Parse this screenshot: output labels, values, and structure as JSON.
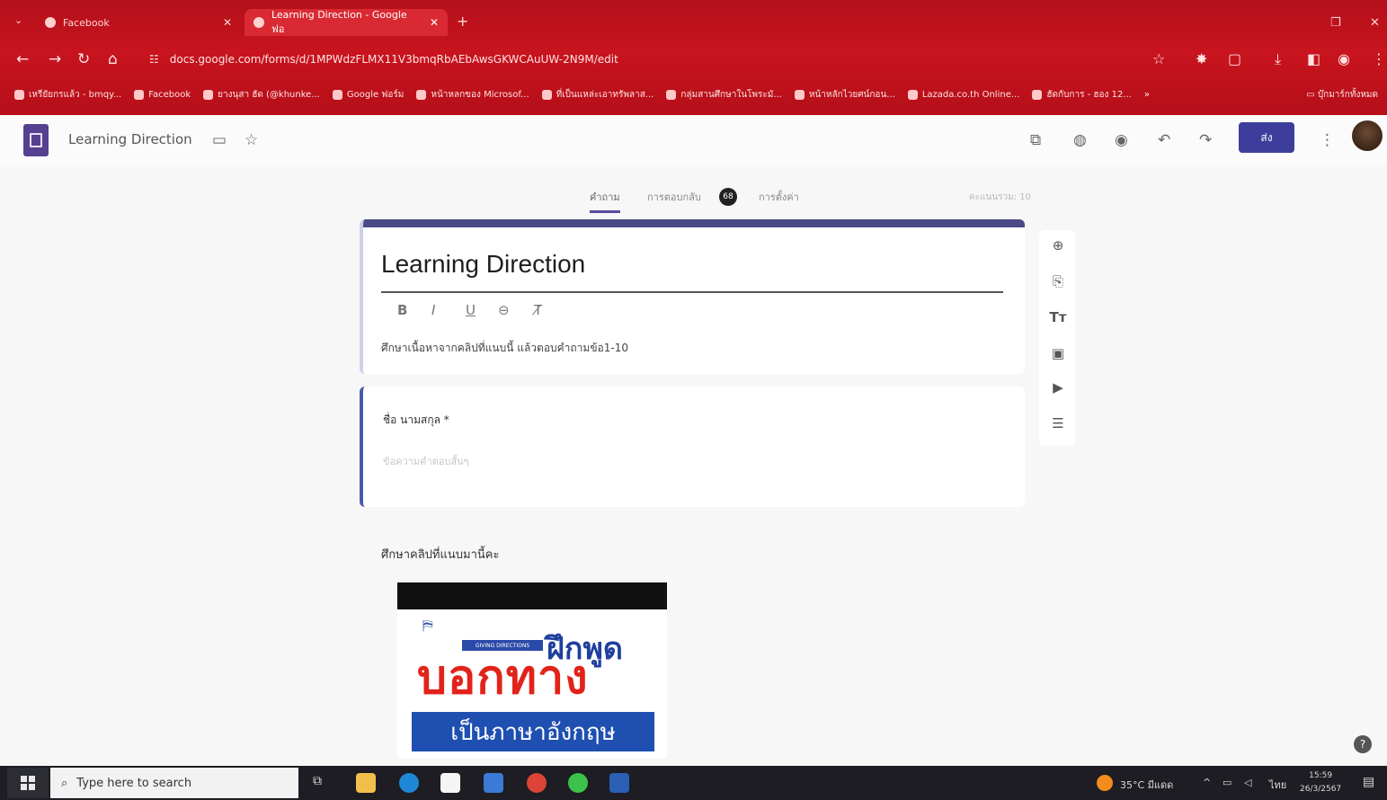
{
  "browser": {
    "tabs": [
      {
        "label": "Facebook"
      },
      {
        "label": "Learning Direction - Google ฟอ"
      }
    ],
    "new_tab": "+",
    "url": "docs.google.com/forms/d/1MPWdzFLMX11V3bmqRbAEbAwsGKWCAuUW-2N9M/edit",
    "bookmarks": [
      "เหรียัยกรแล้ว - bmqy...",
      "Facebook",
      "ยางนุสา ฮัด (@khunke...",
      "Google ฟอร์ม",
      "หน้าหลกของ Microsof...",
      "ที่เป็นแหล่ะเอาทรัพลาส...",
      "กลุ่มสานศึกษาในโพระมั...",
      "หน้าหลักไวยศน์กอน...",
      "Lazada.co.th Online...",
      "ฮัดกับการ - ฮอง 12..."
    ],
    "bookmarks_more": "»",
    "bookmarks_folder": "บุ๊กมาร์กทั้งหมด"
  },
  "app": {
    "doc_title": "Learning Direction",
    "send_label": "ส่ง",
    "tabs": {
      "questions": "คำถาม",
      "responses": "การตอบกลับ",
      "responses_count": "68",
      "settings": "การตั้งค่า",
      "total_score": "คะแนนรวม: 10"
    },
    "form": {
      "title": "Learning Direction",
      "format_bold": "B",
      "format_italic": "I",
      "format_underline": "U",
      "format_link": "⊖",
      "format_clear": "T̸",
      "description": "ศึกษาเนื้อหาจากคลิปที่แนบนี้ แล้วตอบคำถามข้อ1-10",
      "question_label": "ชื่อ นามสกุล *",
      "question_placeholder": "ข้อความคำตอบสั้นๆ",
      "section_label": "ศึกษาคลิปที่แนบมานี้คะ",
      "image_small_logo": "GIVING DIRECTIONS",
      "image_line1": "ฝึกพูด",
      "image_line2": "บอกทาง",
      "image_line3": "เป็นภาษาอังกฤษ"
    },
    "help": "?"
  },
  "taskbar": {
    "search_placeholder": "Type here to search",
    "weather": "35°C มีแดด",
    "lang": "ไทย",
    "time": "15:59",
    "date": "26/3/2567"
  },
  "colors": {
    "chrome_red": "#c8141e",
    "forms_purple": "#4a4a86",
    "send_blue": "#3d3e9b",
    "question_accent": "#4a5aa8"
  }
}
